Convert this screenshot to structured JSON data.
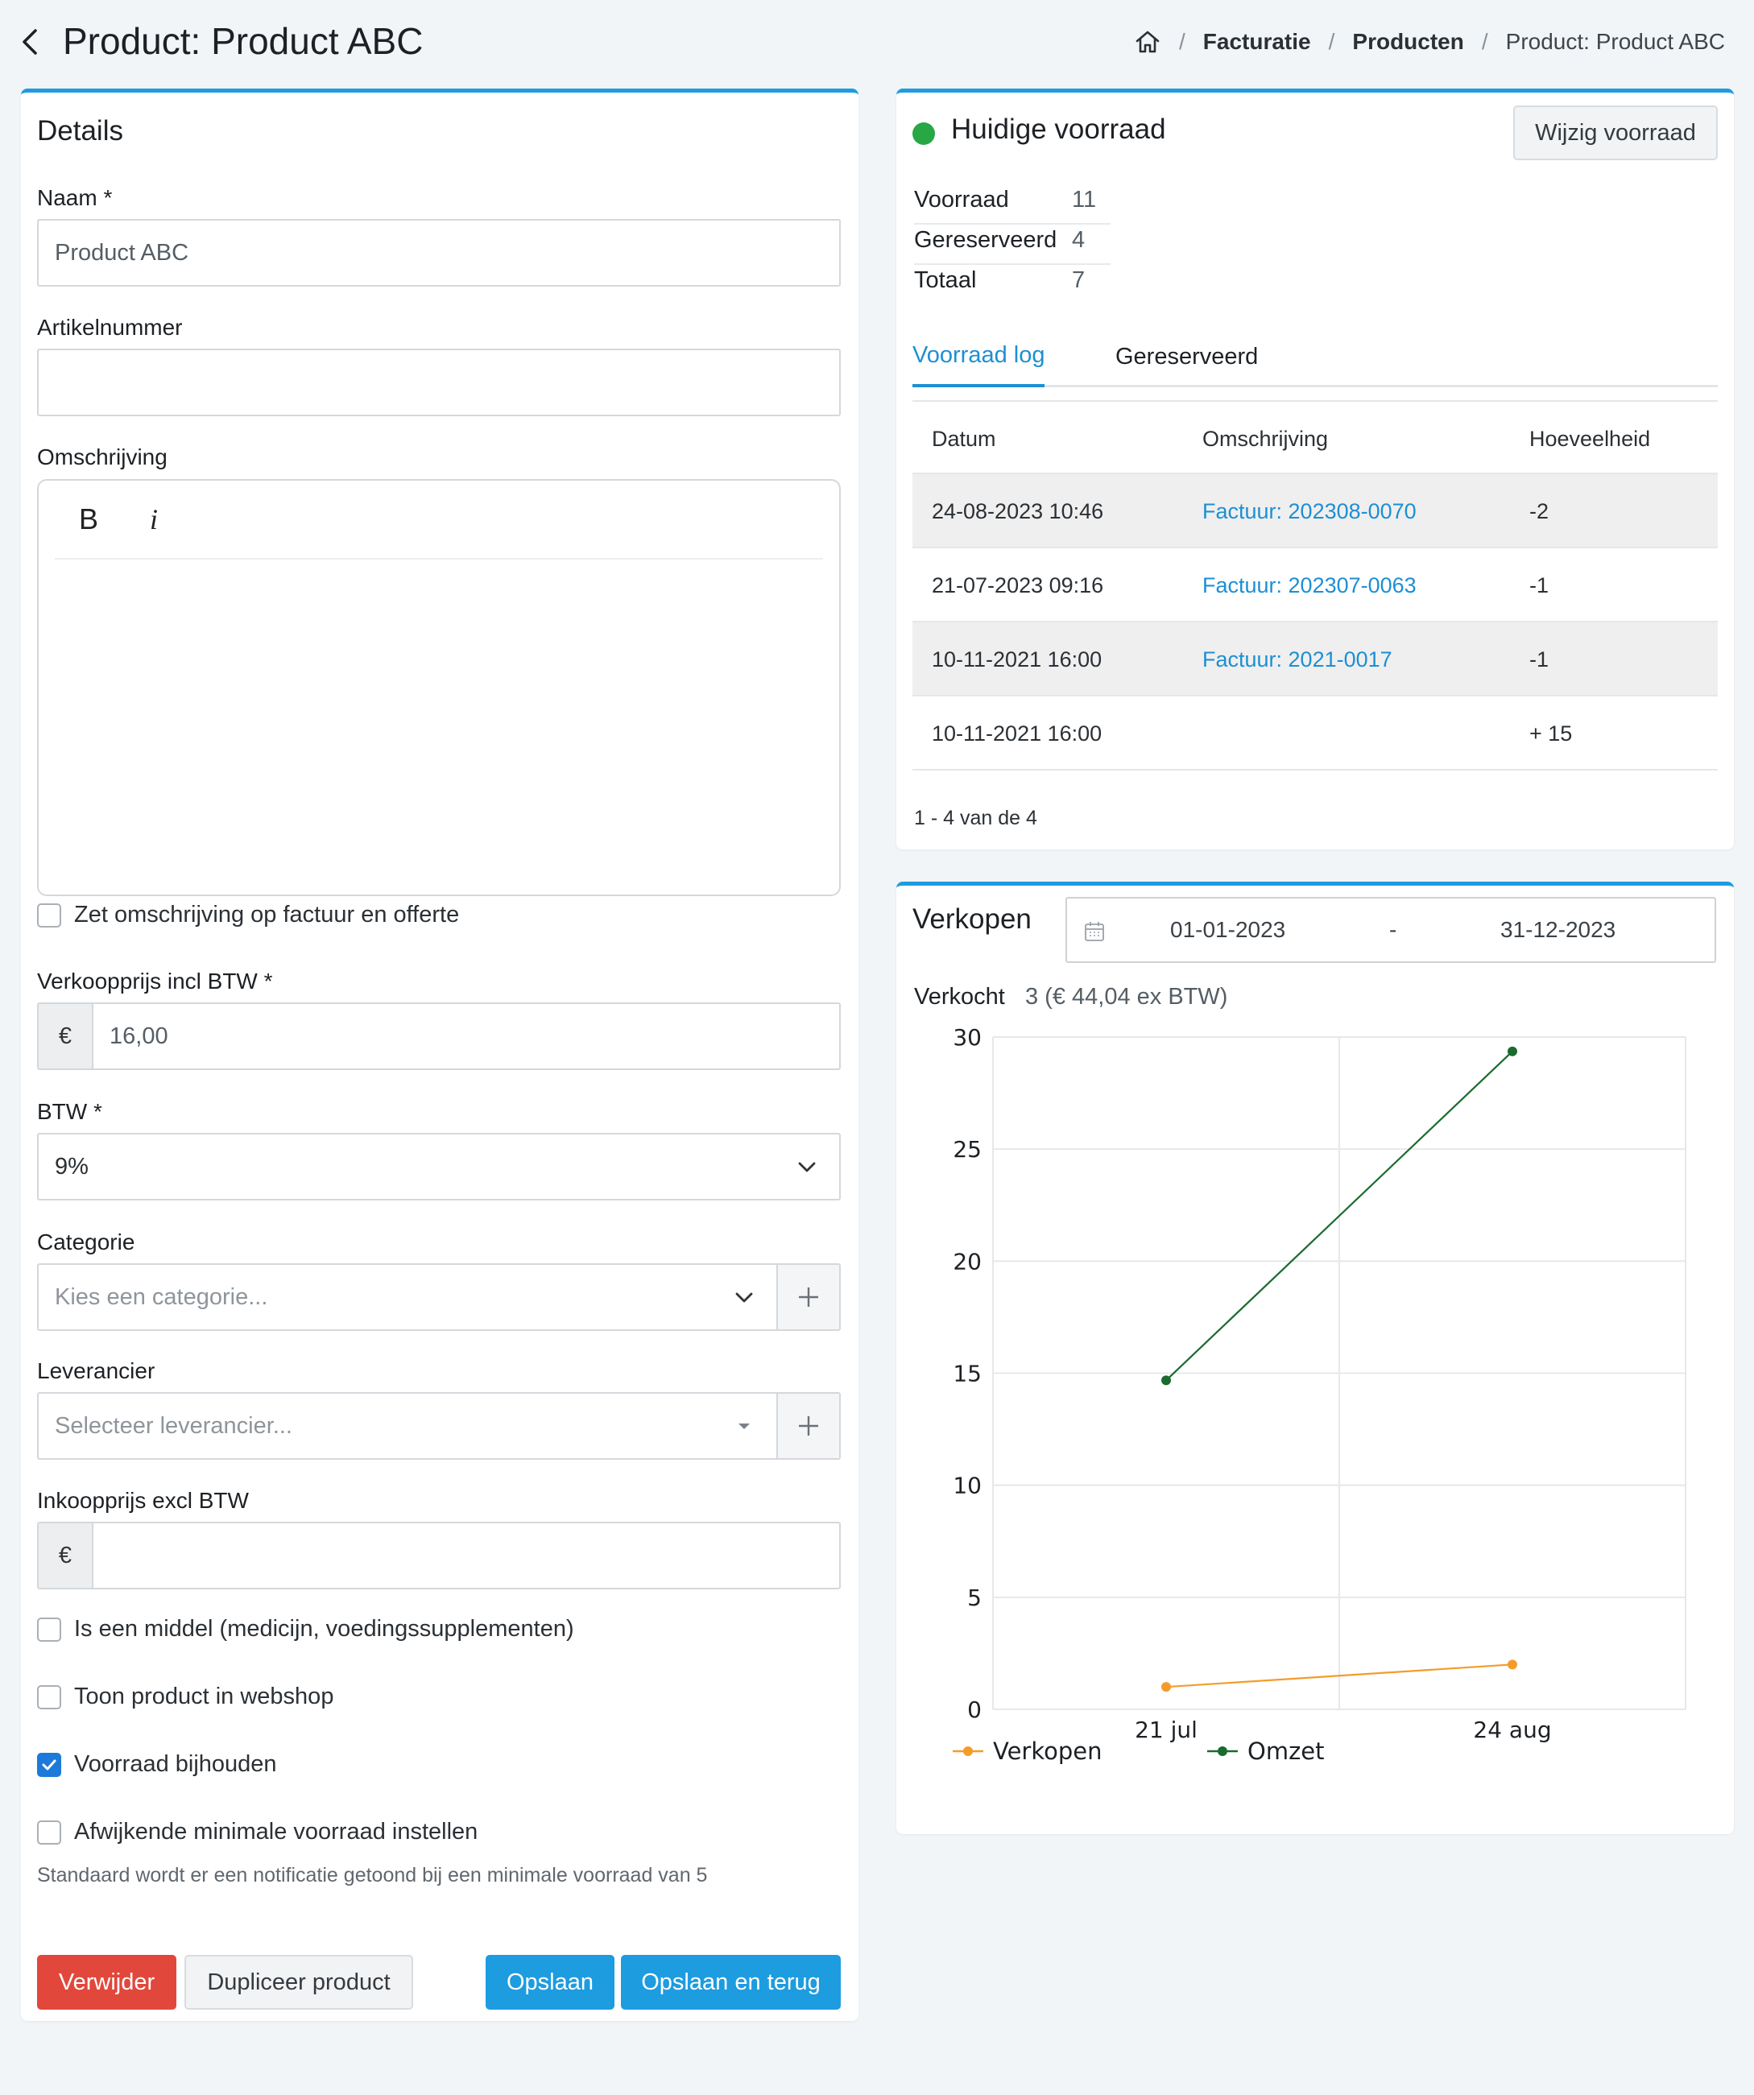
{
  "header": {
    "title": "Product: Product ABC",
    "breadcrumb": [
      "Facturatie",
      "Producten",
      "Product: Product ABC"
    ]
  },
  "details": {
    "title": "Details",
    "name_label": "Naam *",
    "name_value": "Product ABC",
    "sku_label": "Artikelnummer",
    "sku_value": "",
    "description_label": "Omschrijving",
    "editor_bold": "B",
    "editor_italic": "i",
    "desc_on_invoice_label": "Zet omschrijving op factuur en offerte",
    "price_label": "Verkoopprijs incl BTW *",
    "currency_symbol": "€",
    "price_value": "16,00",
    "vat_label": "BTW *",
    "vat_value": "9%",
    "category_label": "Categorie",
    "category_placeholder": "Kies een categorie...",
    "supplier_label": "Leverancier",
    "supplier_placeholder": "Selecteer leverancier...",
    "purchase_label": "Inkoopprijs excl BTW",
    "purchase_value": "",
    "checkbox_medicine": "Is een middel (medicijn, voedingssupplementen)",
    "checkbox_webshop": "Toon product in webshop",
    "checkbox_track_stock": "Voorraad bijhouden",
    "checkbox_min_stock": "Afwijkende minimale voorraad instellen",
    "min_stock_hint": "Standaard wordt er een notificatie getoond bij een minimale voorraad van 5",
    "btn_delete": "Verwijder",
    "btn_duplicate": "Dupliceer product",
    "btn_save": "Opslaan",
    "btn_save_back": "Opslaan en terug"
  },
  "stock": {
    "title": "Huidige voorraad",
    "edit_button": "Wijzig voorraad",
    "status_color": "#28a745",
    "rows": [
      {
        "label": "Voorraad",
        "value": "11"
      },
      {
        "label": "Gereserveerd",
        "value": "4"
      },
      {
        "label": "Totaal",
        "value": "7"
      }
    ],
    "tabs": [
      "Voorraad log",
      "Gereserveerd"
    ],
    "table_headers": [
      "Datum",
      "Omschrijving",
      "Hoeveelheid"
    ],
    "log": [
      {
        "date": "24-08-2023 10:46",
        "desc": "Factuur: 202308-0070",
        "qty": "-2"
      },
      {
        "date": "21-07-2023 09:16",
        "desc": "Factuur: 202307-0063",
        "qty": "-1"
      },
      {
        "date": "10-11-2021 16:00",
        "desc": "Factuur: 2021-0017",
        "qty": "-1"
      },
      {
        "date": "10-11-2021 16:00",
        "desc": "",
        "qty": "+ 15"
      }
    ],
    "pager": "1 - 4 van de 4"
  },
  "sales": {
    "title": "Verkopen",
    "date_from": "01-01-2023",
    "date_sep": "-",
    "date_to": "31-12-2023",
    "sold_label": "Verkocht",
    "sold_value": "3 (€ 44,04 ex BTW)"
  },
  "chart_data": {
    "type": "line",
    "categories": [
      "21 jul",
      "24 aug"
    ],
    "series": [
      {
        "name": "Verkopen",
        "values": [
          1,
          2
        ],
        "color": "#f39c2b"
      },
      {
        "name": "Omzet",
        "values": [
          14.68,
          29.36
        ],
        "color": "#1a6b2e"
      }
    ],
    "ylim": [
      0,
      30
    ],
    "yticks": [
      0,
      5,
      10,
      15,
      20,
      25,
      30
    ],
    "grid": true,
    "legend": "bottom"
  }
}
